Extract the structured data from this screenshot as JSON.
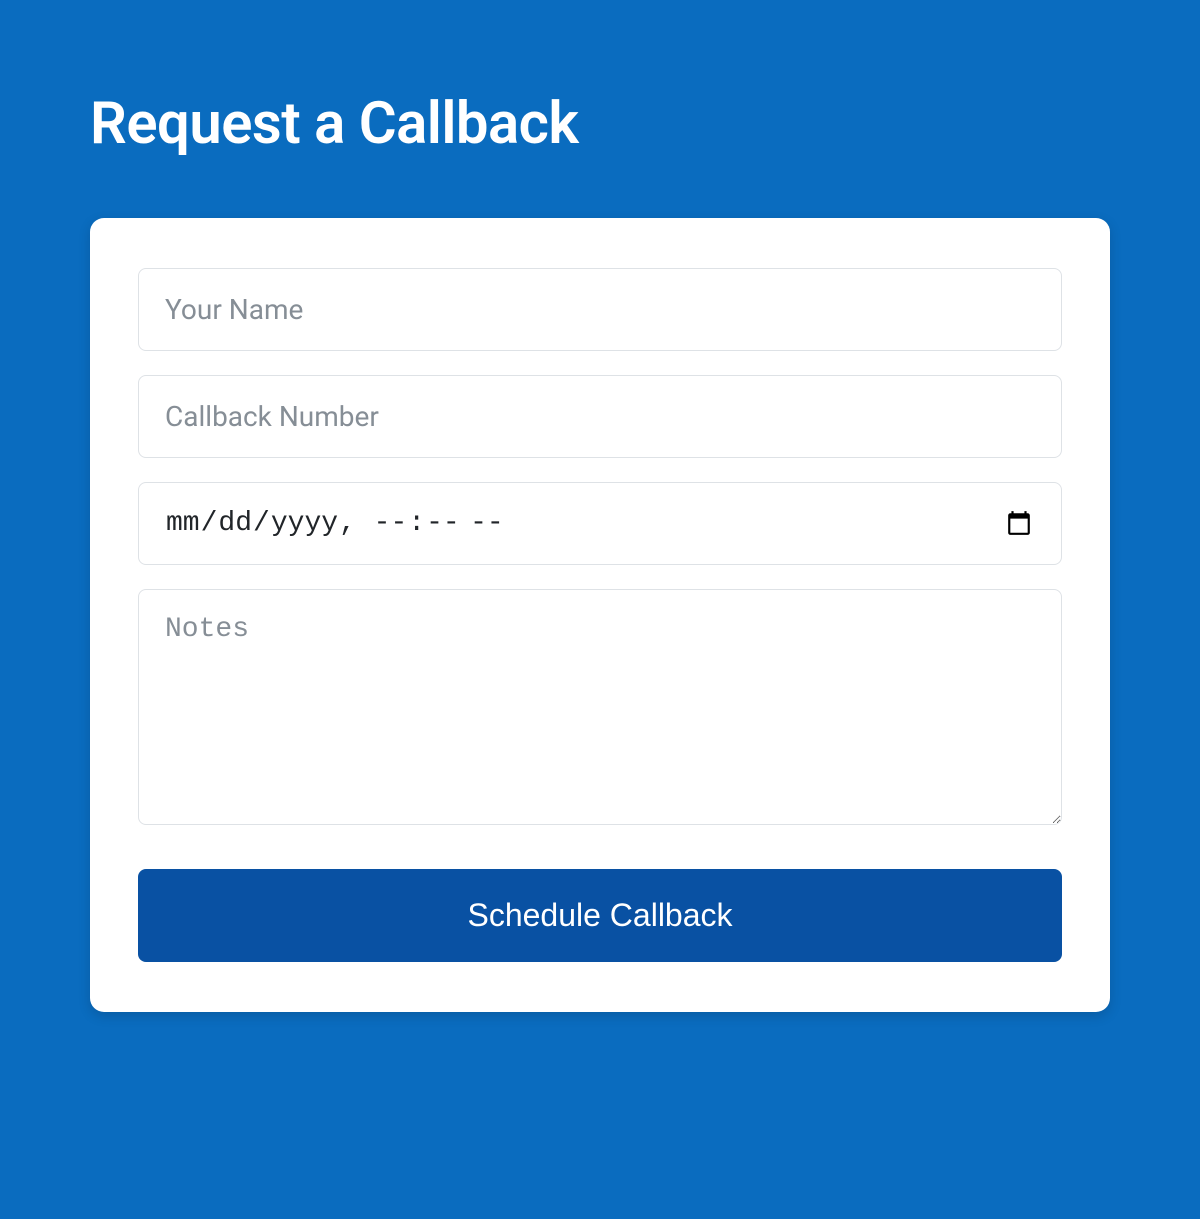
{
  "title": "Request a Callback",
  "form": {
    "name": {
      "placeholder": "Your Name",
      "value": ""
    },
    "callback_number": {
      "placeholder": "Callback Number",
      "value": ""
    },
    "datetime": {
      "value": ""
    },
    "notes": {
      "placeholder": "Notes",
      "value": ""
    },
    "submit_label": "Schedule Callback"
  }
}
